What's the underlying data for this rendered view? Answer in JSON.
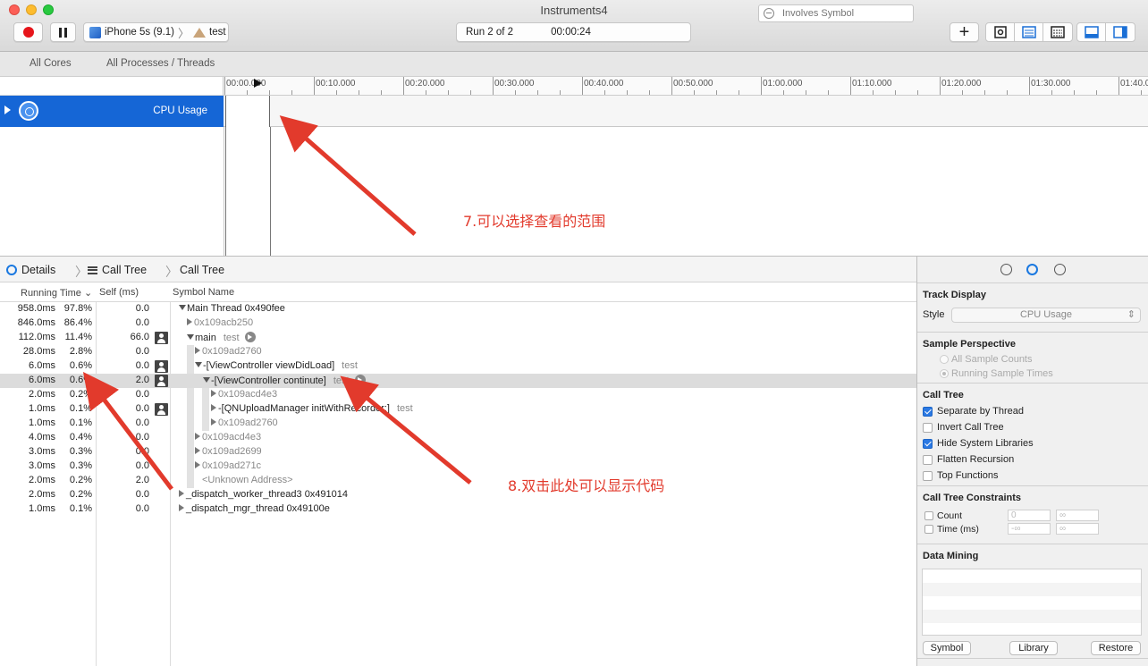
{
  "window": {
    "title": "Instruments4"
  },
  "toolbar": {
    "device": "iPhone 5s (9.1)",
    "target": "test",
    "run": "Run 2 of 2",
    "elapsed": "00:00:24",
    "add_label": "+"
  },
  "filters": {
    "cores": "All Cores",
    "processes": "All Processes / Threads"
  },
  "ruler": {
    "labels": [
      "00:00.000",
      "00:10.000",
      "00:20.000",
      "00:30.000",
      "00:40.000",
      "00:50.000",
      "01:00.000",
      "01:10.000",
      "01:20.000",
      "01:30.000",
      "01:40.0"
    ]
  },
  "track": {
    "label": "CPU Usage"
  },
  "details": {
    "crumb1": "Details",
    "crumb2": "Call Tree",
    "crumb3": "Call Tree",
    "search_placeholder": "Involves Symbol"
  },
  "table": {
    "headers": {
      "running_time": "Running Time",
      "self": "Self (ms)",
      "symbol": "Symbol Name"
    },
    "rows": [
      {
        "rt": "958.0ms",
        "pct": "97.8%",
        "self": "0.0",
        "user": false,
        "depth": 0,
        "tri": "down",
        "sym": "Main Thread  0x490fee",
        "lib": "",
        "gray": false,
        "goto": false
      },
      {
        "rt": "846.0ms",
        "pct": "86.4%",
        "self": "0.0",
        "user": false,
        "depth": 1,
        "tri": "right",
        "sym": "0x109acb250",
        "lib": "",
        "gray": true,
        "goto": false
      },
      {
        "rt": "112.0ms",
        "pct": "11.4%",
        "self": "66.0",
        "user": true,
        "depth": 1,
        "tri": "down",
        "sym": "main",
        "lib": "test",
        "gray": false,
        "goto": true
      },
      {
        "rt": "28.0ms",
        "pct": "2.8%",
        "self": "0.0",
        "user": false,
        "depth": 2,
        "tri": "right",
        "sym": "0x109ad2760",
        "lib": "",
        "gray": true,
        "goto": false
      },
      {
        "rt": "6.0ms",
        "pct": "0.6%",
        "self": "0.0",
        "user": true,
        "depth": 2,
        "tri": "down",
        "sym": "-[ViewController viewDidLoad]",
        "lib": "test",
        "gray": false,
        "goto": false
      },
      {
        "rt": "6.0ms",
        "pct": "0.6%",
        "self": "2.0",
        "user": true,
        "depth": 3,
        "tri": "down",
        "sym": "-[ViewController continute]",
        "lib": "test",
        "gray": false,
        "goto": true,
        "selected": true
      },
      {
        "rt": "2.0ms",
        "pct": "0.2%",
        "self": "0.0",
        "user": false,
        "depth": 4,
        "tri": "right",
        "sym": "0x109acd4e3",
        "lib": "",
        "gray": true,
        "goto": false
      },
      {
        "rt": "1.0ms",
        "pct": "0.1%",
        "self": "0.0",
        "user": true,
        "depth": 4,
        "tri": "right",
        "sym": "-[QNUploadManager initWithRecorder:]",
        "lib": "test",
        "gray": false,
        "goto": false
      },
      {
        "rt": "1.0ms",
        "pct": "0.1%",
        "self": "0.0",
        "user": false,
        "depth": 4,
        "tri": "right",
        "sym": "0x109ad2760",
        "lib": "",
        "gray": true,
        "goto": false
      },
      {
        "rt": "4.0ms",
        "pct": "0.4%",
        "self": "0.0",
        "user": false,
        "depth": 2,
        "tri": "right",
        "sym": "0x109acd4e3",
        "lib": "",
        "gray": true,
        "goto": false
      },
      {
        "rt": "3.0ms",
        "pct": "0.3%",
        "self": "0.0",
        "user": false,
        "depth": 2,
        "tri": "right",
        "sym": "0x109ad2699",
        "lib": "",
        "gray": true,
        "goto": false
      },
      {
        "rt": "3.0ms",
        "pct": "0.3%",
        "self": "0.0",
        "user": false,
        "depth": 2,
        "tri": "right",
        "sym": "0x109ad271c",
        "lib": "",
        "gray": true,
        "goto": false
      },
      {
        "rt": "2.0ms",
        "pct": "0.2%",
        "self": "2.0",
        "user": false,
        "depth": 2,
        "tri": "none",
        "sym": "<Unknown Address>",
        "lib": "",
        "gray": true,
        "goto": false
      },
      {
        "rt": "2.0ms",
        "pct": "0.2%",
        "self": "0.0",
        "user": false,
        "depth": 0,
        "tri": "right",
        "sym": "_dispatch_worker_thread3  0x491014",
        "lib": "",
        "gray": false,
        "goto": false
      },
      {
        "rt": "1.0ms",
        "pct": "0.1%",
        "self": "0.0",
        "user": false,
        "depth": 0,
        "tri": "right",
        "sym": "_dispatch_mgr_thread  0x49100e",
        "lib": "",
        "gray": false,
        "goto": false
      }
    ]
  },
  "inspector": {
    "track_display": {
      "title": "Track Display",
      "style_label": "Style",
      "style_value": "CPU Usage"
    },
    "sample_perspective": {
      "title": "Sample Perspective",
      "opt1": "All Sample Counts",
      "opt2": "Running Sample Times"
    },
    "call_tree": {
      "title": "Call Tree",
      "options": [
        {
          "label": "Separate by Thread",
          "checked": true
        },
        {
          "label": "Invert Call Tree",
          "checked": false
        },
        {
          "label": "Hide System Libraries",
          "checked": true
        },
        {
          "label": "Flatten Recursion",
          "checked": false
        },
        {
          "label": "Top Functions",
          "checked": false
        }
      ]
    },
    "constraints": {
      "title": "Call Tree Constraints",
      "count_label": "Count",
      "time_label": "Time (ms)",
      "count_min": "0",
      "count_max": "∞",
      "time_min": "-∞",
      "time_max": "∞"
    },
    "data_mining": {
      "title": "Data Mining",
      "symbol": "Symbol",
      "library": "Library",
      "restore": "Restore"
    }
  },
  "annotations": {
    "note7": "7.可以选择查看的范围",
    "note8": "8.双击此处可以显示代码",
    "color": "#e23a2c"
  }
}
